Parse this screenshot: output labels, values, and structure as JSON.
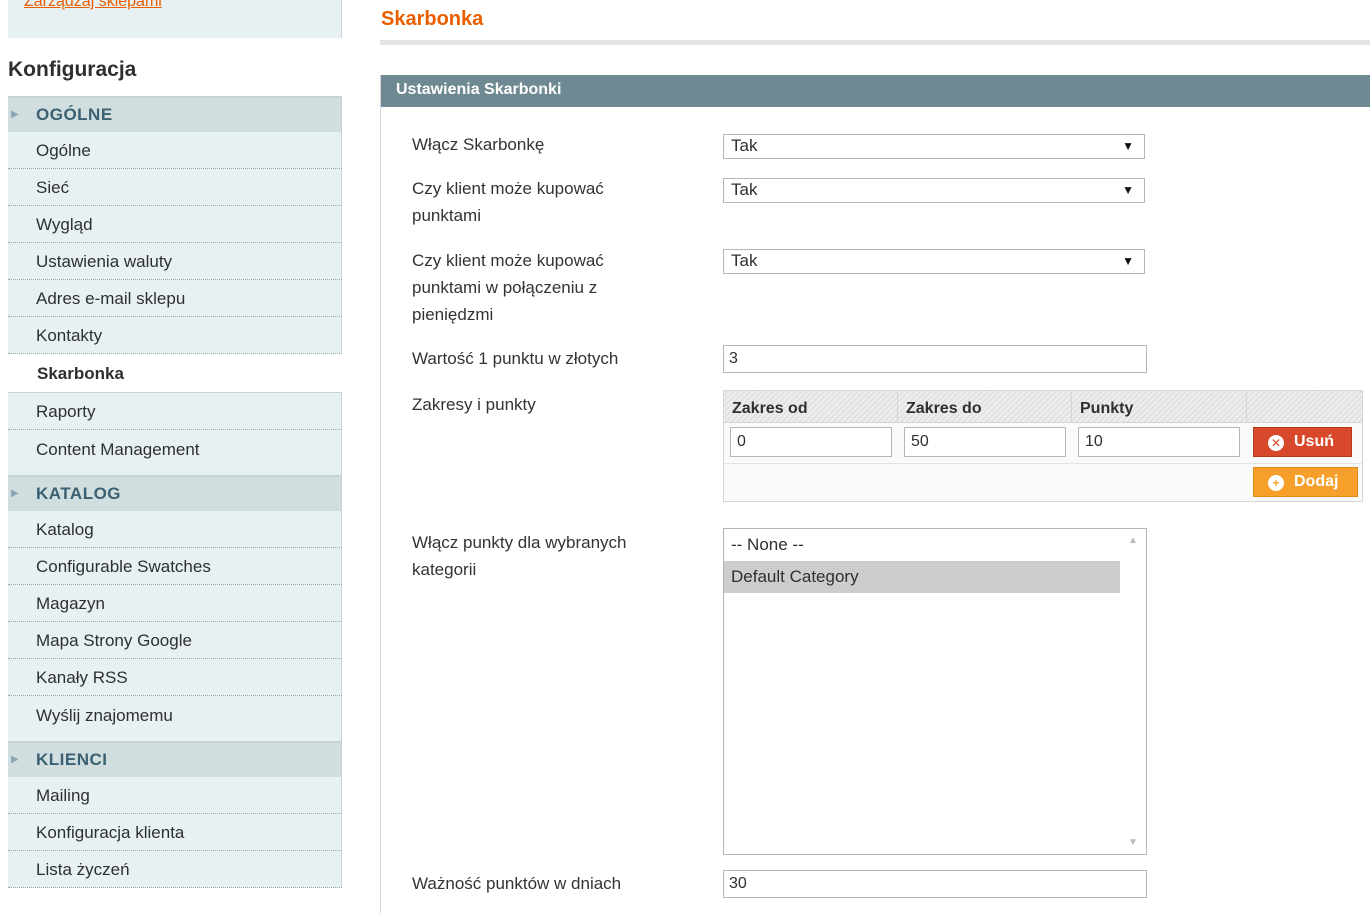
{
  "sidebar": {
    "manage_link": "Zarządzaj sklepami",
    "title": "Konfiguracja",
    "sections": [
      {
        "label": "OGÓLNE",
        "items": [
          "Ogólne",
          "Sieć",
          "Wygląd",
          "Ustawienia waluty",
          "Adres e-mail sklepu",
          "Kontakty",
          "Skarbonka",
          "Raporty",
          "Content Management"
        ]
      },
      {
        "label": "KATALOG",
        "items": [
          "Katalog",
          "Configurable Swatches",
          "Magazyn",
          "Mapa Strony Google",
          "Kanały RSS",
          "Wyślij znajomemu"
        ]
      },
      {
        "label": "KLIENCI",
        "items": [
          "Mailing",
          "Konfiguracja klienta",
          "Lista życzeń"
        ]
      }
    ],
    "active_item": "Skarbonka"
  },
  "main": {
    "page_title": "Skarbonka",
    "fieldset_title": "Ustawienia Skarbonki",
    "fields": {
      "enable": {
        "label": "Włącz Skarbonkę",
        "value": "Tak"
      },
      "buy_points": {
        "label": "Czy klient może kupować punktami",
        "value": "Tak"
      },
      "buy_points_money": {
        "label": "Czy klient może kupować punktami w połączeniu z pieniędzmi",
        "value": "Tak"
      },
      "point_value": {
        "label": "Wartość 1 punktu w złotych",
        "value": "3"
      },
      "ranges": {
        "label": "Zakresy i punkty",
        "columns": [
          "Zakres od",
          "Zakres do",
          "Punkty"
        ],
        "rows": [
          {
            "from": "0",
            "to": "50",
            "points": "10"
          }
        ],
        "delete_label": "Usuń",
        "add_label": "Dodaj"
      },
      "categories": {
        "label": "Włącz punkty dla wybranych kategorii",
        "options": [
          "-- None --",
          "Default Category"
        ],
        "selected": "Default Category"
      },
      "validity": {
        "label": "Ważność punktów w dniach",
        "value": "30"
      }
    }
  },
  "colors": {
    "accent": "#eb5e00",
    "sidebar_bg": "#e7f1f4",
    "section_bg": "#d1dedf",
    "header_bg": "#6f8992",
    "delete_btn": "#d8492b",
    "add_btn": "#f6a02b"
  }
}
